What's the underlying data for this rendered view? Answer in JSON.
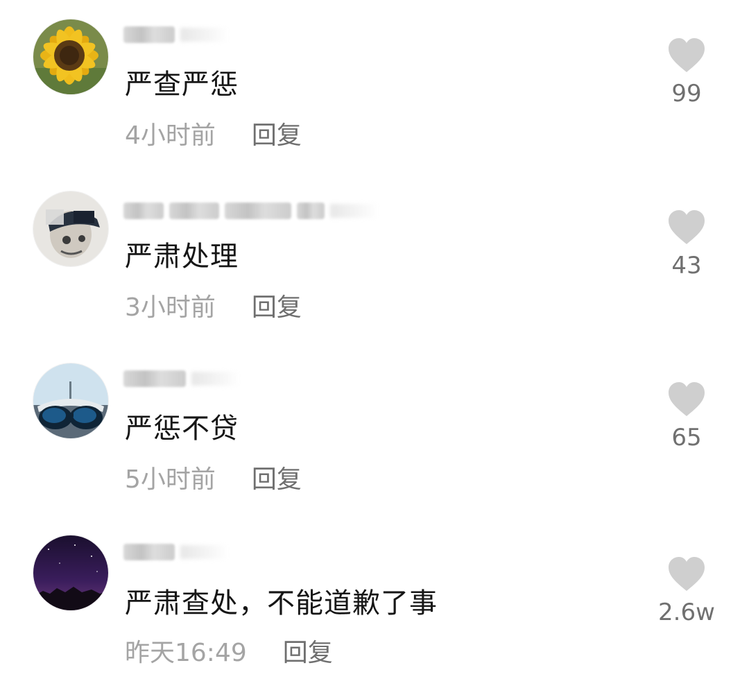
{
  "comments": [
    {
      "text": "严查严惩",
      "time": "4小时前",
      "reply_label": "回复",
      "likes": "99",
      "avatar": "sunflower",
      "username_blurred": true
    },
    {
      "text": "严肃处理",
      "time": "3小时前",
      "reply_label": "回复",
      "likes": "43",
      "avatar": "person-with-cap",
      "username_blurred": true
    },
    {
      "text": "严惩不贷",
      "time": "5小时前",
      "reply_label": "回复",
      "likes": "65",
      "avatar": "sunglasses",
      "username_blurred": true
    },
    {
      "text": "严肃查处，不能道歉了事",
      "time": "昨天16:49",
      "reply_label": "回复",
      "likes": "2.6w",
      "avatar": "night-sky",
      "username_blurred": true
    }
  ],
  "colors": {
    "text": "#161616",
    "meta": "#a4a4a4",
    "reply": "#6f6f6f",
    "heart": "#cfcfcf",
    "likes": "#707070"
  },
  "icons": {
    "like": "heart-icon"
  }
}
